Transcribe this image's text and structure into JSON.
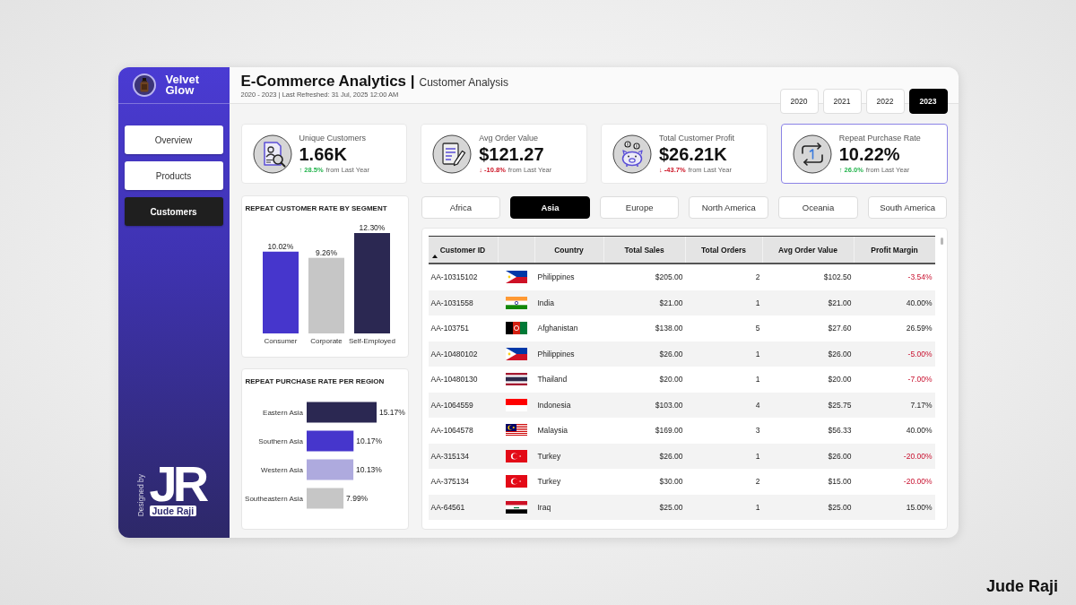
{
  "brand": {
    "name": "Velvet Glow"
  },
  "header": {
    "title": "E-Commerce Analytics |",
    "page": "Customer Analysis",
    "subtitle": "2020 - 2023 | Last Refreshed: 31 Jul, 2025 12:00 AM"
  },
  "years": [
    {
      "label": "2020",
      "selected": false
    },
    {
      "label": "2021",
      "selected": false
    },
    {
      "label": "2022",
      "selected": false
    },
    {
      "label": "2023",
      "selected": true
    }
  ],
  "sidebar": {
    "items": [
      {
        "label": "Overview",
        "selected": false
      },
      {
        "label": "Products",
        "selected": false
      },
      {
        "label": "Customers",
        "selected": true
      }
    ],
    "credit": {
      "designed_by": "Designed by",
      "monogram": "JR",
      "designer": "Jude Raji"
    }
  },
  "kpis": [
    {
      "kind": "customers",
      "label": "Unique Customers",
      "value": "1.66K",
      "change": "↑ 28.5%",
      "rising": true,
      "note": "from Last Year",
      "highlighted": false
    },
    {
      "kind": "order",
      "label": "Avg Order Value",
      "value": "$121.27",
      "change": "↓ -10.8%",
      "rising": false,
      "note": "from Last Year",
      "highlighted": false
    },
    {
      "kind": "profit",
      "label": "Total Customer Profit",
      "value": "$26.21K",
      "change": "↓ -43.7%",
      "rising": false,
      "note": "from Last Year",
      "highlighted": false
    },
    {
      "kind": "repeat",
      "label": "Repeat Purchase Rate",
      "value": "10.22%",
      "change": "↑ 26.0%",
      "rising": true,
      "note": "from Last Year",
      "highlighted": true
    }
  ],
  "segment_chart": {
    "chart_data": {
      "type": "bar",
      "title": "REPEAT CUSTOMER RATE BY SEGMENT",
      "orientation": "vertical",
      "categories": [
        "Consumer",
        "Corporate",
        "Self-Employed"
      ],
      "series": [
        {
          "values": [
            10.02,
            9.26,
            12.3
          ],
          "colors": [
            "#4636cc",
            "#c6c6c6",
            "#2b2852"
          ],
          "value_labels": [
            "10.02%",
            "9.26%",
            "12.30%"
          ]
        }
      ],
      "data_labels": true
    }
  },
  "region_chart": {
    "chart_data": {
      "type": "bar",
      "title": "REPEAT PURCHASE RATE PER REGION",
      "orientation": "horizontal",
      "categories": [
        "Eastern Asia",
        "Southern Asia",
        "Western Asia",
        "Southeastern Asia"
      ],
      "series": [
        {
          "values": [
            15.17,
            10.17,
            10.13,
            7.99
          ],
          "colors": [
            "#2b2852",
            "#4636cc",
            "#aeaade",
            "#c6c6c6"
          ],
          "value_labels": [
            "15.17%",
            "10.17%",
            "10.13%",
            "7.99%"
          ]
        }
      ],
      "data_labels": true
    }
  },
  "regions": [
    {
      "label": "Africa",
      "selected": false
    },
    {
      "label": "Asia",
      "selected": true
    },
    {
      "label": "Europe",
      "selected": false
    },
    {
      "label": "North America",
      "selected": false
    },
    {
      "label": "Oceania",
      "selected": false
    },
    {
      "label": "South America",
      "selected": false
    }
  ],
  "table": {
    "columns": [
      {
        "kind": "text",
        "label": "Customer ID",
        "sorted": true
      },
      {
        "kind": "flag",
        "sorted": false
      },
      {
        "kind": "text",
        "label": "Country",
        "sorted": false
      },
      {
        "kind": "number",
        "label": "Total Sales",
        "sorted": false
      },
      {
        "kind": "number",
        "label": "Total Orders",
        "sorted": false
      },
      {
        "kind": "number",
        "label": "Avg Order Value",
        "sorted": false
      },
      {
        "kind": "margin",
        "label": "Profit Margin",
        "sorted": false
      }
    ],
    "rows": [
      {
        "kind": "philippines",
        "cells": [
          "AA-10315102",
          "Philippines",
          "$205.00",
          "2",
          "$102.50",
          "-3.54%"
        ],
        "loss": true
      },
      {
        "kind": "india",
        "cells": [
          "AA-1031558",
          "India",
          "$21.00",
          "1",
          "$21.00",
          "40.00%"
        ],
        "loss": false
      },
      {
        "kind": "afghanistan",
        "cells": [
          "AA-103751",
          "Afghanistan",
          "$138.00",
          "5",
          "$27.60",
          "26.59%"
        ],
        "loss": false
      },
      {
        "kind": "philippines",
        "cells": [
          "AA-10480102",
          "Philippines",
          "$26.00",
          "1",
          "$26.00",
          "-5.00%"
        ],
        "loss": true
      },
      {
        "kind": "thailand",
        "cells": [
          "AA-10480130",
          "Thailand",
          "$20.00",
          "1",
          "$20.00",
          "-7.00%"
        ],
        "loss": true
      },
      {
        "kind": "indonesia",
        "cells": [
          "AA-1064559",
          "Indonesia",
          "$103.00",
          "4",
          "$25.75",
          "7.17%"
        ],
        "loss": false
      },
      {
        "kind": "malaysia",
        "cells": [
          "AA-1064578",
          "Malaysia",
          "$169.00",
          "3",
          "$56.33",
          "40.00%"
        ],
        "loss": false
      },
      {
        "kind": "turkey",
        "cells": [
          "AA-315134",
          "Turkey",
          "$26.00",
          "1",
          "$26.00",
          "-20.00%"
        ],
        "loss": true
      },
      {
        "kind": "turkey",
        "cells": [
          "AA-375134",
          "Turkey",
          "$30.00",
          "2",
          "$15.00",
          "-20.00%"
        ],
        "loss": true
      },
      {
        "kind": "iraq",
        "cells": [
          "AA-64561",
          "Iraq",
          "$25.00",
          "1",
          "$25.00",
          "15.00%"
        ],
        "loss": false
      }
    ]
  },
  "signature": "Jude Raji"
}
